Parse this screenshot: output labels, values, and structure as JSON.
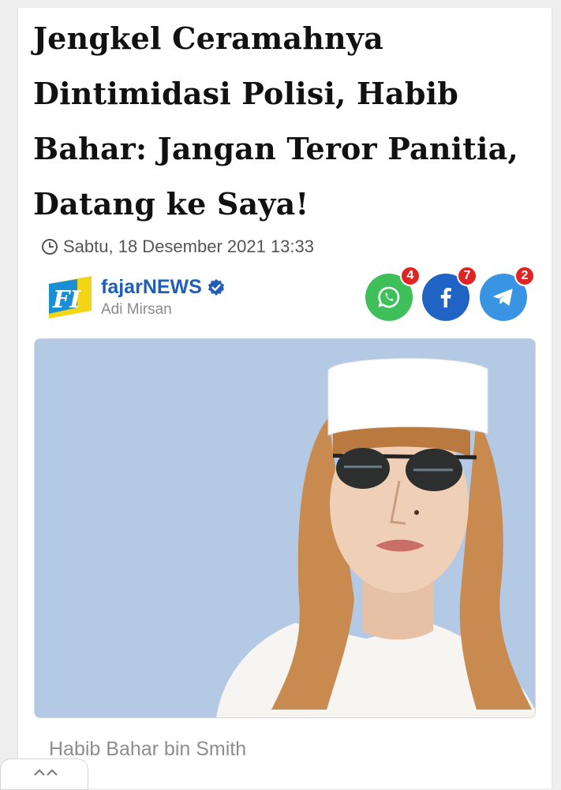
{
  "article": {
    "headline": "Jengkel Ceramahnya Dintimidasi Polisi, Habib Bahar: Jangan Teror Panitia, Datang ke Saya!",
    "date": "Sabtu, 18 Desember 2021 13:33",
    "caption": "Habib Bahar bin Smith"
  },
  "source": {
    "brand_prefix": "fajar",
    "brand_suffix": "NEWS",
    "author": "Adi Mirsan",
    "logo_letters": "FI"
  },
  "share": {
    "whatsapp_count": "4",
    "facebook_count": "7",
    "telegram_count": "2"
  },
  "colors": {
    "brand": "#1f5fb8",
    "whatsapp": "#3fbf5a",
    "facebook": "#1f63c4",
    "telegram": "#3a94e4",
    "badge": "#e02323",
    "photo_background": "#b4c9e4"
  },
  "icons": [
    "clock-icon",
    "verified-icon",
    "whatsapp-icon",
    "facebook-icon",
    "telegram-icon",
    "chevron-up-icon"
  ]
}
